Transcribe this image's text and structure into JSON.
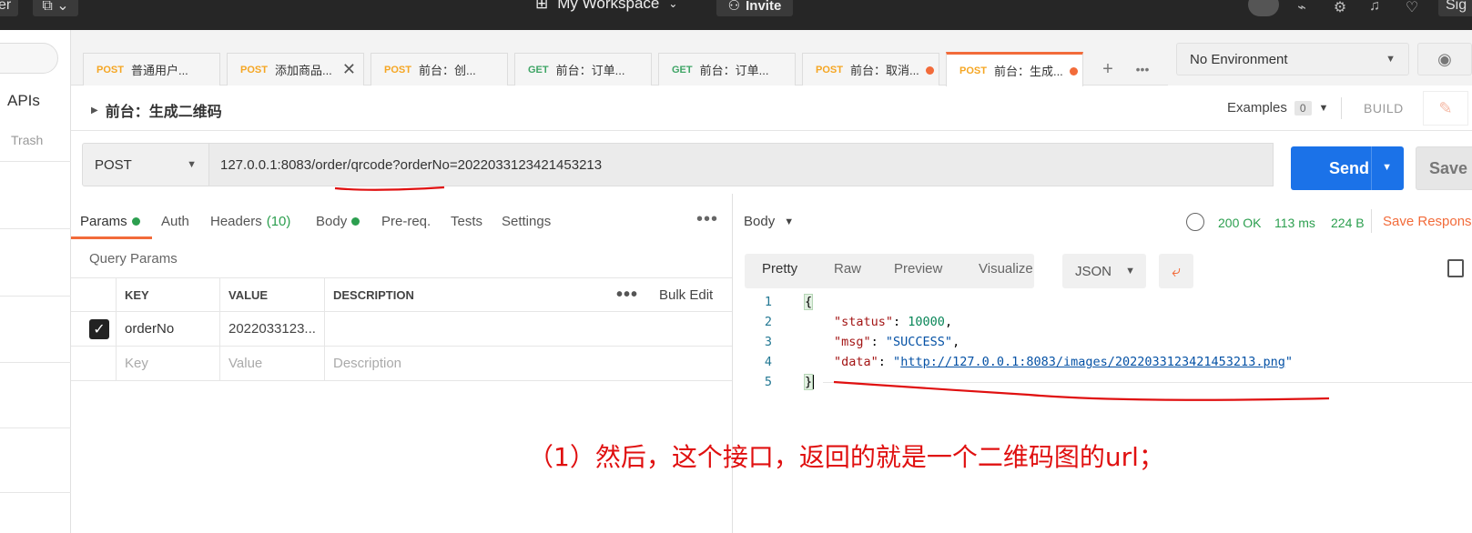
{
  "topbar": {
    "left_btn_text": "er",
    "workspace_label": "My Workspace",
    "invite_label": "Invite",
    "signin_label": "Sig"
  },
  "sidebar": {
    "apis_label": "APIs",
    "trash_label": "Trash"
  },
  "tabs": [
    {
      "method": "POST",
      "label": "普通用户..."
    },
    {
      "method": "POST",
      "label": "添加商品..."
    },
    {
      "method": "POST",
      "label": "前台：创..."
    },
    {
      "method": "GET",
      "label": "前台：订单..."
    },
    {
      "method": "GET",
      "label": "前台：订单..."
    },
    {
      "method": "POST",
      "label": "前台：取消..."
    },
    {
      "method": "POST",
      "label": "前台：生成..."
    }
  ],
  "environment": {
    "selected": "No Environment"
  },
  "request": {
    "title": "前台：生成二维码",
    "examples_label": "Examples",
    "examples_count": "0",
    "build_label": "BUILD",
    "method": "POST",
    "url": "127.0.0.1:8083/order/qrcode?orderNo=2022033123421453213",
    "send_label": "Send",
    "save_label": "Save"
  },
  "request_tabs": {
    "params": "Params",
    "auth": "Auth",
    "headers": "Headers",
    "headers_count": "(10)",
    "body": "Body",
    "prereq": "Pre-req.",
    "tests": "Tests",
    "settings": "Settings"
  },
  "params": {
    "section_title": "Query Params",
    "columns": [
      "KEY",
      "VALUE",
      "DESCRIPTION"
    ],
    "bulk_edit": "Bulk Edit",
    "rows": [
      {
        "checked": true,
        "key": "orderNo",
        "value": "2022033123...",
        "description": ""
      }
    ],
    "placeholder": {
      "key": "Key",
      "value": "Value",
      "description": "Description"
    }
  },
  "response": {
    "body_label": "Body",
    "status": "200 OK",
    "time": "113 ms",
    "size": "224 B",
    "save_response": "Save Respons",
    "view_tabs": [
      "Pretty",
      "Raw",
      "Preview",
      "Visualize"
    ],
    "format": "JSON",
    "lines": {
      "l1": "{",
      "l2_key": "\"status\"",
      "l2_val": "10000",
      "l3_key": "\"msg\"",
      "l3_val": "\"SUCCESS\"",
      "l4_key": "\"data\"",
      "l4_val": "http://127.0.0.1:8083/images/2022033123421453213.png",
      "l5": "}"
    },
    "line_numbers": [
      "1",
      "2",
      "3",
      "4",
      "5"
    ]
  },
  "annotation": {
    "text": "（1）然后，这个接口，返回的就是一个二维码图的url；",
    "color": "#e01010"
  },
  "colors": {
    "accent": "#f26b3a",
    "send": "#1b72e8",
    "post": "#f5a623",
    "get": "#3fa566",
    "success": "#2c9f4f"
  }
}
